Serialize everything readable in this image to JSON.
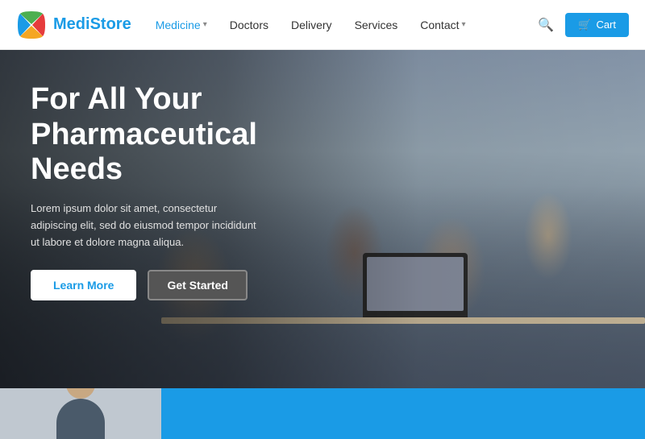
{
  "header": {
    "logo_name": "MediStore",
    "logo_name_part1": "Medi",
    "logo_name_part2": "Store",
    "nav": [
      {
        "label": "Medicine",
        "active": true,
        "has_dropdown": true
      },
      {
        "label": "Doctors",
        "active": false,
        "has_dropdown": false
      },
      {
        "label": "Delivery",
        "active": false,
        "has_dropdown": false
      },
      {
        "label": "Services",
        "active": false,
        "has_dropdown": false
      },
      {
        "label": "Contact",
        "active": false,
        "has_dropdown": true
      }
    ],
    "cart_label": "Cart"
  },
  "hero": {
    "title": "For All Your Pharmaceutical Needs",
    "description": "Lorem ipsum dolor sit amet, consectetur adipiscing elit, sed do eiusmod tempor incididunt ut labore et dolore magna aliqua.",
    "btn_learn": "Learn More",
    "btn_started": "Get Started"
  },
  "colors": {
    "primary": "#1a9be6",
    "white": "#ffffff",
    "dark": "#333333"
  }
}
